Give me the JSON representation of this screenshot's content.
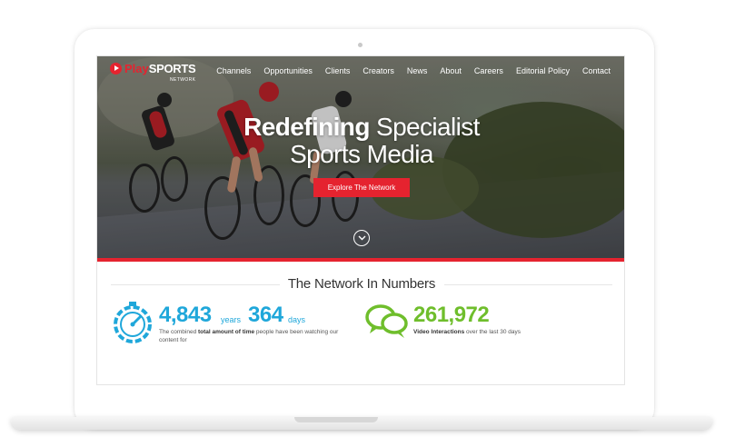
{
  "brand": {
    "play": "Play",
    "sports": "SPORTS",
    "sub": "NETWORK",
    "accent": "#e5232f"
  },
  "nav": {
    "items": [
      "Channels",
      "Opportunities",
      "Clients",
      "Creators",
      "News",
      "About",
      "Careers",
      "Editorial Policy",
      "Contact"
    ]
  },
  "hero": {
    "headline_bold": "Redefining",
    "headline_rest": " Specialist",
    "headline_line2": "Sports Media",
    "cta_label": "Explore The Network",
    "scroll_icon": "chevron-down-icon"
  },
  "numbers": {
    "title": "The Network In Numbers",
    "time": {
      "icon": "stopwatch-icon",
      "years_value": "4,843",
      "years_unit": "years",
      "days_value": "364",
      "days_unit": "days",
      "desc_pre": "The combined ",
      "desc_bold": "total amount of time",
      "desc_post": " people have been watching our content for",
      "color": "#1fa7da"
    },
    "interactions": {
      "icon": "speech-bubbles-icon",
      "value": "261,972",
      "desc_bold": "Video Interactions",
      "desc_post": " over the last 30 days",
      "color": "#6fbe2c"
    }
  }
}
